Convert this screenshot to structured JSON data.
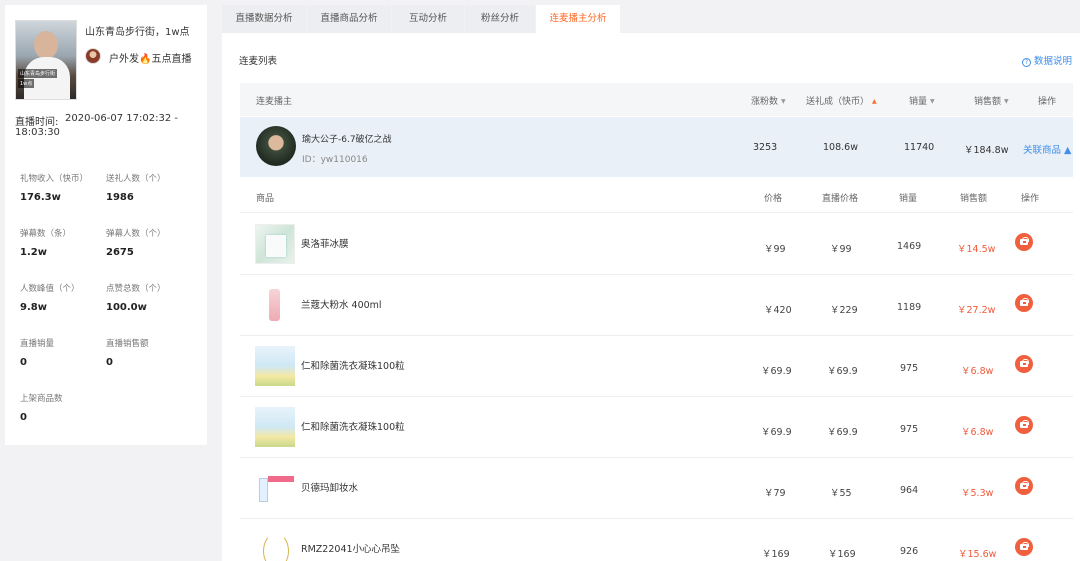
{
  "left_panel": {
    "title": "山东青岛步行街，1w点",
    "cover_tag": "山东青岛步行街",
    "cover_tag2": "1w点",
    "anchor_name_prefix": "户外发",
    "anchor_fire": "🔥",
    "anchor_name_suffix": "五点直播",
    "live_time_label": "直播时间:",
    "live_time_start": "2020-06-07 17:02:32 -",
    "live_time_end": "18:03:30",
    "stats": [
      {
        "label": "礼物收入（快币）",
        "value": "176.3w"
      },
      {
        "label": "送礼人数（个）",
        "value": "1986"
      },
      {
        "label": "弹幕数（条）",
        "value": "1.2w"
      },
      {
        "label": "弹幕人数（个）",
        "value": "2675"
      },
      {
        "label": "人数峰值（个）",
        "value": "9.8w"
      },
      {
        "label": "点赞总数（个）",
        "value": "100.0w"
      },
      {
        "label": "直播销量",
        "value": "0"
      },
      {
        "label": "直播销售额",
        "value": "0"
      },
      {
        "label": "上架商品数",
        "value": "0"
      }
    ]
  },
  "tabs": [
    "直播数据分析",
    "直播商品分析",
    "互动分析",
    "粉丝分析",
    "连麦播主分析"
  ],
  "main": {
    "section_title": "连麦列表",
    "help_icon": "?",
    "help_label": "数据说明",
    "header": {
      "anchor": "连麦播主",
      "fans": "涨粉数",
      "gift": "送礼成（快币）",
      "sales": "销量",
      "revenue": "销售额",
      "action": "操作",
      "sort_down": "▼",
      "sort_up": "▲"
    },
    "mic_anchor": {
      "name": "瑜大公子-6.7破亿之战",
      "id": "ID：yw110016",
      "fans": "3253",
      "gift": "108.6w",
      "sales": "11740",
      "revenue": "￥184.8w",
      "link": "关联商品 ▲"
    },
    "product_header": {
      "product": "商品",
      "price": "价格",
      "live_price": "直播价格",
      "sales": "销量",
      "revenue": "销售额",
      "action": "操作"
    },
    "products": [
      {
        "name": "奥洛菲冰膜",
        "price": "￥99",
        "live_price": "￥99",
        "sales": "1469",
        "revenue": "￥14.5w"
      },
      {
        "name": "兰蔻大粉水 400ml",
        "price": "￥420",
        "live_price": "￥229",
        "sales": "1189",
        "revenue": "￥27.2w"
      },
      {
        "name": "仁和除菌洗衣凝珠100粒",
        "price": "￥69.9",
        "live_price": "￥69.9",
        "sales": "975",
        "revenue": "￥6.8w"
      },
      {
        "name": "仁和除菌洗衣凝珠100粒",
        "price": "￥69.9",
        "live_price": "￥69.9",
        "sales": "975",
        "revenue": "￥6.8w"
      },
      {
        "name": "贝德玛卸妆水",
        "price": "￥79",
        "live_price": "￥55",
        "sales": "964",
        "revenue": "￥5.3w"
      },
      {
        "name": "RMZ22041小心心吊坠",
        "price": "￥169",
        "live_price": "￥169",
        "sales": "926",
        "revenue": "￥15.6w"
      }
    ]
  }
}
